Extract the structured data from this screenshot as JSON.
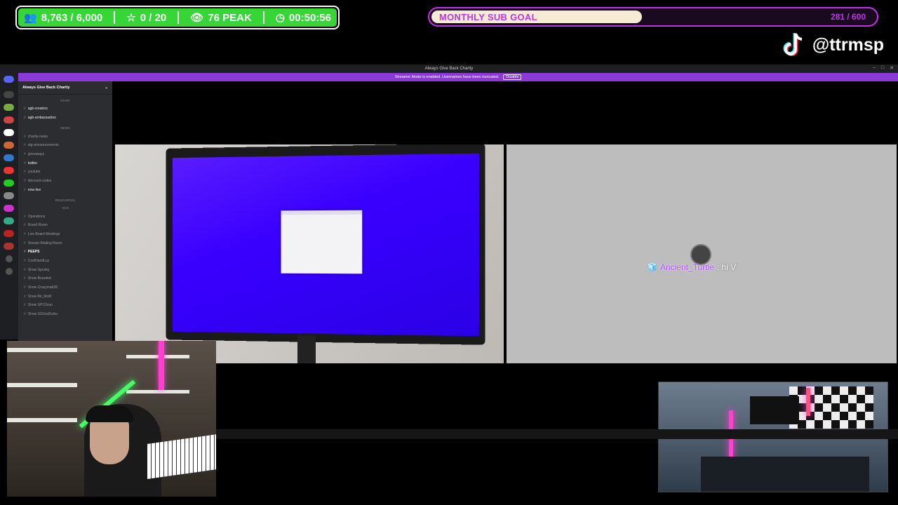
{
  "stats": {
    "followers": "8,763 / 6,000",
    "stars": "0 / 20",
    "peak": "76 PEAK",
    "timer": "00:50:56"
  },
  "goal": {
    "label": "MONTHLY SUB GOAL",
    "count": "281 / 600",
    "progress": 0.47
  },
  "tiktok": {
    "handle": "@ttrmsp"
  },
  "discord": {
    "window_title": "Always Give Back Charity",
    "banner_text": "Streamer Mode is enabled. Usernames have been truncated.",
    "banner_button": "Disable",
    "server_name": "Always Give Back Charity",
    "categories": [
      "STAFF",
      "NEWS",
      "RESOURCES",
      "VCS"
    ],
    "channels": [
      {
        "name": "agb-creators",
        "bright": true
      },
      {
        "name": "agb-ambassadors",
        "bright": true
      },
      {
        "name": "charity-news",
        "bright": false
      },
      {
        "name": "alg-announcements",
        "bright": false
      },
      {
        "name": "giveaways",
        "bright": false
      },
      {
        "name": "twitter",
        "bright": true
      },
      {
        "name": "youtube",
        "bright": false
      },
      {
        "name": "discount-codes",
        "bright": false
      },
      {
        "name": "now-live",
        "bright": true
      },
      {
        "name": "Operations",
        "bright": false
      },
      {
        "name": "Board Room",
        "bright": false
      },
      {
        "name": "Live Board Meetings",
        "bright": false
      },
      {
        "name": "Stream Waiting Room",
        "bright": false
      },
      {
        "name": "PEEPS",
        "bright": true
      },
      {
        "name": "CoolHandLuy",
        "bright": false
      },
      {
        "name": "Show Spooky",
        "bright": false
      },
      {
        "name": "Show Bearded",
        "bright": false
      },
      {
        "name": "Show Crazymatt28",
        "bright": false
      },
      {
        "name": "Show Mr_MoM",
        "bright": false
      },
      {
        "name": "Show SPCGrun",
        "bright": false
      },
      {
        "name": "Show SSGodGoho",
        "bright": false
      }
    ]
  },
  "chat": {
    "user": "Ancient_Turtle",
    "message": ": hi V"
  }
}
